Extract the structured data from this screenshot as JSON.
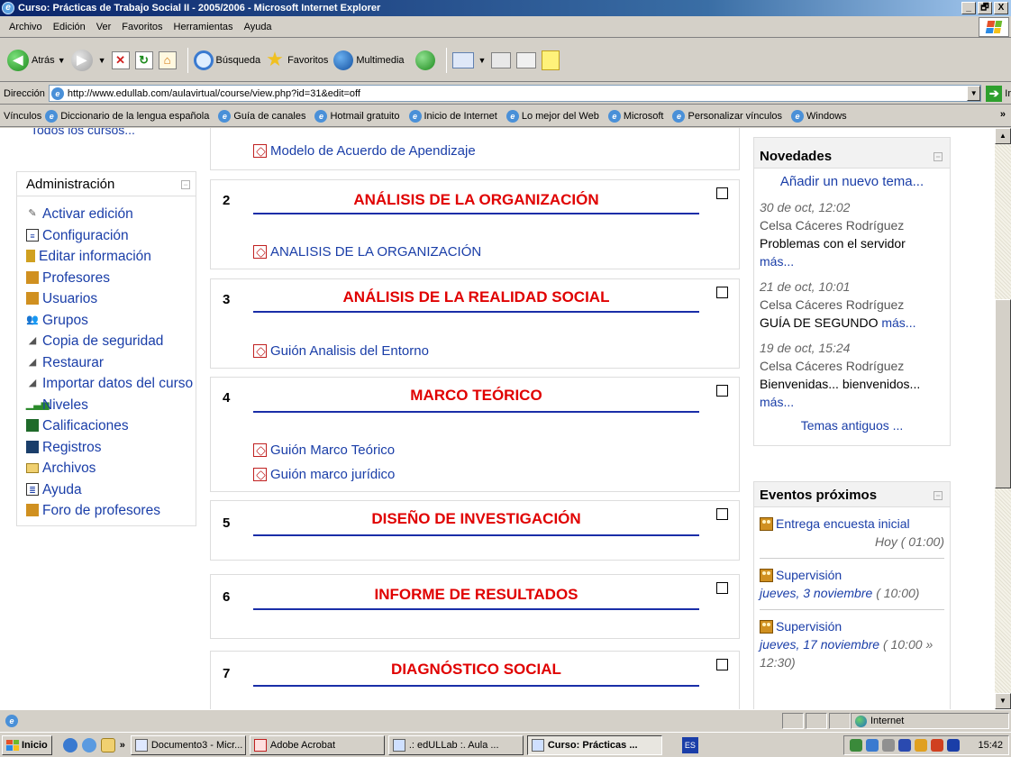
{
  "window": {
    "title": "Curso: Prácticas de Trabajo Social II - 2005/2006 - Microsoft Internet Explorer",
    "minimize": "_",
    "maximize": "🗗",
    "close": "X"
  },
  "menu": [
    "Archivo",
    "Edición",
    "Ver",
    "Favoritos",
    "Herramientas",
    "Ayuda"
  ],
  "toolbar": {
    "back": "Atrás",
    "search": "Búsqueda",
    "favorites": "Favoritos",
    "media": "Multimedia"
  },
  "address": {
    "label": "Dirección",
    "url": "http://www.edullab.com/aulavirtual/course/view.php?id=31&edit=off",
    "go": "Ir"
  },
  "links": {
    "label": "Vínculos",
    "items": [
      "Diccionario de la lengua española",
      "Guía de canales",
      "Hotmail gratuito",
      "Inicio de Internet",
      "Lo mejor del Web",
      "Microsoft",
      "Personalizar vínculos",
      "Windows"
    ],
    "more": "»"
  },
  "left": {
    "all_courses": "Todos los cursos...",
    "admin_title": "Administración",
    "admin_items": [
      {
        "label": "Activar edición",
        "icon": "edit-icon"
      },
      {
        "label": "Configuración",
        "icon": "settings-icon"
      },
      {
        "label": "Editar información",
        "icon": "info-icon"
      },
      {
        "label": "Profesores",
        "icon": "teachers-icon"
      },
      {
        "label": "Usuarios",
        "icon": "users-icon"
      },
      {
        "label": "Grupos",
        "icon": "groups-icon"
      },
      {
        "label": "Copia de seguridad",
        "icon": "backup-icon"
      },
      {
        "label": "Restaurar",
        "icon": "restore-icon"
      },
      {
        "label": "Importar datos del curso",
        "icon": "import-icon"
      },
      {
        "label": "Niveles",
        "icon": "scales-icon"
      },
      {
        "label": "Calificaciones",
        "icon": "grades-icon"
      },
      {
        "label": "Registros",
        "icon": "logs-icon"
      },
      {
        "label": "Archivos",
        "icon": "folder-icon"
      },
      {
        "label": "Ayuda",
        "icon": "help-icon"
      },
      {
        "label": "Foro de profesores",
        "icon": "forum-icon"
      }
    ]
  },
  "center": {
    "top_resource": "Modelo de Acuerdo de Apendizaje",
    "sections": [
      {
        "num": "2",
        "title": "ANÁLISIS DE LA ORGANIZACIÓN",
        "resources": [
          "ANALISIS DE LA ORGANIZACIÓN"
        ]
      },
      {
        "num": "3",
        "title": "ANÁLISIS DE LA REALIDAD SOCIAL",
        "resources": [
          "Guión Analisis del Entorno"
        ]
      },
      {
        "num": "4",
        "title": "MARCO TEÓRICO",
        "resources": [
          "Guión Marco Teórico",
          "Guión marco jurídico"
        ]
      },
      {
        "num": "5",
        "title": "DISEÑO DE INVESTIGACIÓN",
        "resources": []
      },
      {
        "num": "6",
        "title": "INFORME DE RESULTADOS",
        "resources": []
      },
      {
        "num": "7",
        "title": "DIAGNÓSTICO SOCIAL",
        "resources": []
      }
    ]
  },
  "news": {
    "title": "Novedades",
    "add": "Añadir un nuevo tema...",
    "items": [
      {
        "date": "30 de oct, 12:02",
        "author": "Celsa Cáceres Rodríguez",
        "text": "Problemas con el servidor",
        "more": "más..."
      },
      {
        "date": "21 de oct, 10:01",
        "author": "Celsa Cáceres Rodríguez",
        "text": "GUÍA DE SEGUNDO",
        "more": "más..."
      },
      {
        "date": "19 de oct, 15:24",
        "author": "Celsa Cáceres Rodríguez",
        "text": "Bienvenidas... bienvenidos...",
        "more": "más..."
      }
    ],
    "old": "Temas antiguos ..."
  },
  "events": {
    "title": "Eventos próximos",
    "items": [
      {
        "title": "Entrega encuesta inicial",
        "when": "",
        "time": "Hoy ( 01:00)"
      },
      {
        "title": "Supervisión",
        "when": "jueves, 3 noviembre",
        "time": "( 10:00)"
      },
      {
        "title": "Supervisión",
        "when": "jueves, 17 noviembre",
        "time": "( 10:00 » 12:30)"
      }
    ]
  },
  "status": {
    "zone": "Internet"
  },
  "taskbar": {
    "start": "Inicio",
    "more": "»",
    "tasks": [
      "Documento3 - Micr...",
      "Adobe Acrobat",
      ".: edULLab :. Aula ...",
      "Curso: Prácticas ..."
    ],
    "lang": "ES",
    "clock": "15:42"
  }
}
